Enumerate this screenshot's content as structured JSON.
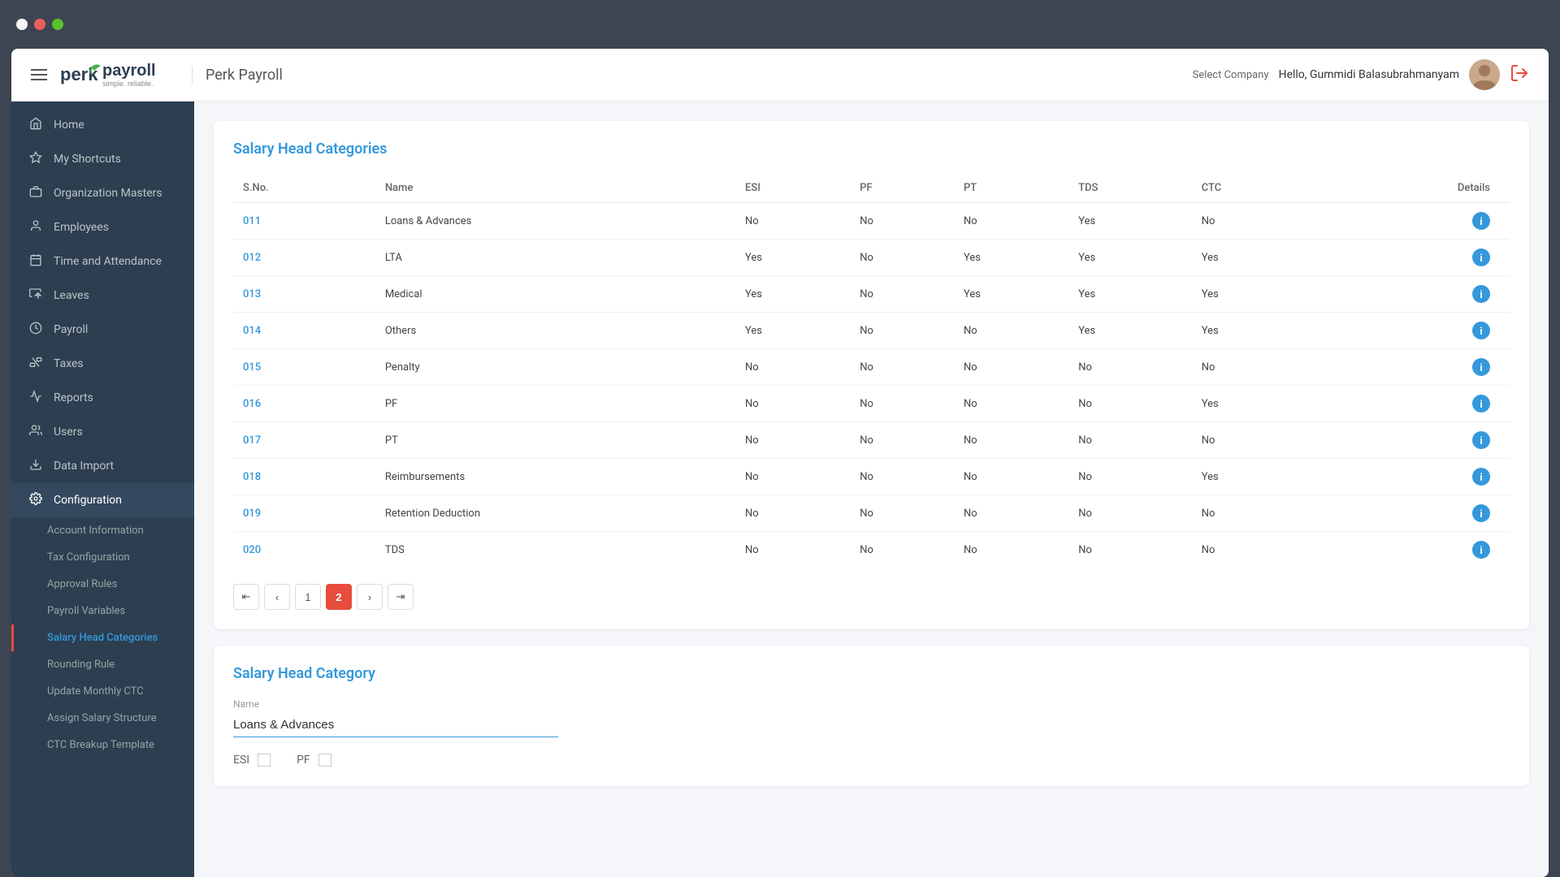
{
  "titleBar": {
    "windowControls": [
      "close",
      "minimize",
      "maximize"
    ]
  },
  "header": {
    "appTitle": "Perk Payroll",
    "logoText": "perk",
    "logoSubtext": "simple. reliable.",
    "selectCompanyLabel": "Select Company",
    "userName": "Hello, Gummidi Balasubrahmanyam",
    "logoutLabel": "Logout"
  },
  "sidebar": {
    "navItems": [
      {
        "id": "home",
        "label": "Home",
        "icon": "🏠"
      },
      {
        "id": "shortcuts",
        "label": "My Shortcuts",
        "icon": "⭐"
      },
      {
        "id": "org-masters",
        "label": "Organization Masters",
        "icon": "🏢"
      },
      {
        "id": "employees",
        "label": "Employees",
        "icon": "👤"
      },
      {
        "id": "time-attendance",
        "label": "Time and Attendance",
        "icon": "📅"
      },
      {
        "id": "leaves",
        "label": "Leaves",
        "icon": "✈"
      },
      {
        "id": "payroll",
        "label": "Payroll",
        "icon": "💰"
      },
      {
        "id": "taxes",
        "label": "Taxes",
        "icon": "📊"
      },
      {
        "id": "reports",
        "label": "Reports",
        "icon": "📈"
      },
      {
        "id": "users",
        "label": "Users",
        "icon": "👥"
      },
      {
        "id": "data-import",
        "label": "Data Import",
        "icon": "📥"
      },
      {
        "id": "configuration",
        "label": "Configuration",
        "icon": "⚙️"
      }
    ],
    "subItems": [
      {
        "id": "account-info",
        "label": "Account Information"
      },
      {
        "id": "tax-config",
        "label": "Tax Configuration"
      },
      {
        "id": "approval-rules",
        "label": "Approval Rules"
      },
      {
        "id": "payroll-variables",
        "label": "Payroll Variables"
      },
      {
        "id": "salary-head-categories",
        "label": "Salary Head Categories",
        "active": true
      },
      {
        "id": "rounding-rule",
        "label": "Rounding Rule"
      },
      {
        "id": "update-monthly-ctc",
        "label": "Update Monthly CTC"
      },
      {
        "id": "assign-salary-structure",
        "label": "Assign Salary Structure"
      },
      {
        "id": "ctc-breakup-template",
        "label": "CTC Breakup Template"
      }
    ]
  },
  "salaryHeadCategoriesSection": {
    "title": "Salary Head Categories",
    "tableHeaders": [
      "S.No.",
      "Name",
      "ESI",
      "PF",
      "PT",
      "TDS",
      "CTC",
      "Details"
    ],
    "rows": [
      {
        "sno": "011",
        "name": "Loans & Advances",
        "esi": "No",
        "pf": "No",
        "pt": "No",
        "tds": "Yes",
        "ctc": "No"
      },
      {
        "sno": "012",
        "name": "LTA",
        "esi": "Yes",
        "pf": "No",
        "pt": "Yes",
        "tds": "Yes",
        "ctc": "Yes"
      },
      {
        "sno": "013",
        "name": "Medical",
        "esi": "Yes",
        "pf": "No",
        "pt": "Yes",
        "tds": "Yes",
        "ctc": "Yes"
      },
      {
        "sno": "014",
        "name": "Others",
        "esi": "Yes",
        "pf": "No",
        "pt": "No",
        "tds": "Yes",
        "ctc": "Yes"
      },
      {
        "sno": "015",
        "name": "Penalty",
        "esi": "No",
        "pf": "No",
        "pt": "No",
        "tds": "No",
        "ctc": "No"
      },
      {
        "sno": "016",
        "name": "PF",
        "esi": "No",
        "pf": "No",
        "pt": "No",
        "tds": "No",
        "ctc": "Yes"
      },
      {
        "sno": "017",
        "name": "PT",
        "esi": "No",
        "pf": "No",
        "pt": "No",
        "tds": "No",
        "ctc": "No"
      },
      {
        "sno": "018",
        "name": "Reimbursements",
        "esi": "No",
        "pf": "No",
        "pt": "No",
        "tds": "No",
        "ctc": "Yes"
      },
      {
        "sno": "019",
        "name": "Retention Deduction",
        "esi": "No",
        "pf": "No",
        "pt": "No",
        "tds": "No",
        "ctc": "No"
      },
      {
        "sno": "020",
        "name": "TDS",
        "esi": "No",
        "pf": "No",
        "pt": "No",
        "tds": "No",
        "ctc": "No"
      }
    ],
    "pagination": {
      "pages": [
        "1",
        "2"
      ],
      "currentPage": "2",
      "firstLabel": "«",
      "prevLabel": "‹",
      "nextLabel": "›",
      "lastLabel": "»"
    }
  },
  "salaryHeadCategoryForm": {
    "title": "Salary Head Category",
    "nameLabel": "Name",
    "nameValue": "Loans & Advances",
    "esiLabel": "ESI",
    "pfLabel": "PF"
  }
}
